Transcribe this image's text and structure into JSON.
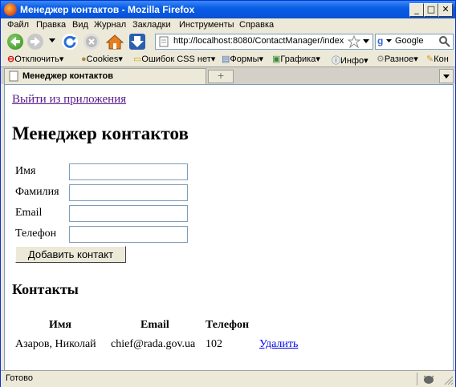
{
  "window": {
    "title": "Менеджер контактов - Mozilla Firefox",
    "minimize_glyph": "_",
    "maximize_glyph": "□",
    "close_glyph": "✕"
  },
  "menu": [
    "Файл",
    "Правка",
    "Вид",
    "Журнал",
    "Закладки",
    "Инструменты",
    "Справка"
  ],
  "navigation": {
    "url": "http://localhost:8080/ContactManager/index",
    "search_engine": "Google",
    "search_placeholder": "Google"
  },
  "devbar": [
    "Отключить",
    "Cookies",
    "Ошибок CSS нет",
    "Формы",
    "Графика",
    "Инфо",
    "Разное",
    "Кон"
  ],
  "tab": {
    "label": "Менеджер контактов",
    "new_tab_glyph": "+"
  },
  "page": {
    "logout_link": "Выйти из приложения",
    "heading": "Менеджер контактов",
    "form": {
      "name_label": "Имя",
      "surname_label": "Фамилия",
      "email_label": "Email",
      "phone_label": "Телефон",
      "name_value": "",
      "surname_value": "",
      "email_value": "",
      "phone_value": "",
      "submit_label": "Добавить контакт"
    },
    "contacts_heading": "Контакты",
    "table": {
      "headers": [
        "Имя",
        "Email",
        "Телефон"
      ],
      "rows": [
        {
          "name": "Азаров, Николай",
          "email": "chief@rada.gov.ua",
          "phone": "102",
          "action": "Удалить"
        }
      ]
    }
  },
  "status": {
    "text": "Готово"
  }
}
